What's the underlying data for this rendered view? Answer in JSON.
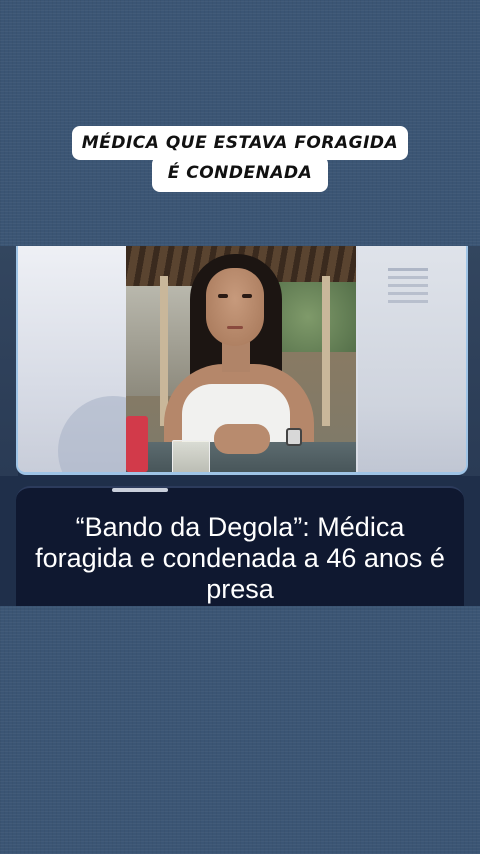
{
  "caption": {
    "line1": "MÉDICA QUE ESTAVA FORAGIDA",
    "line2": "É CONDENADA"
  },
  "article": {
    "headline": "“Bando da Degola”: Médica foragida e condenada a 46 anos é presa"
  },
  "colors": {
    "background": "#3b5574",
    "caption_bg": "#ffffff",
    "headline_card_bg": "#0f1830",
    "panel_border": "#9fc4e6"
  }
}
